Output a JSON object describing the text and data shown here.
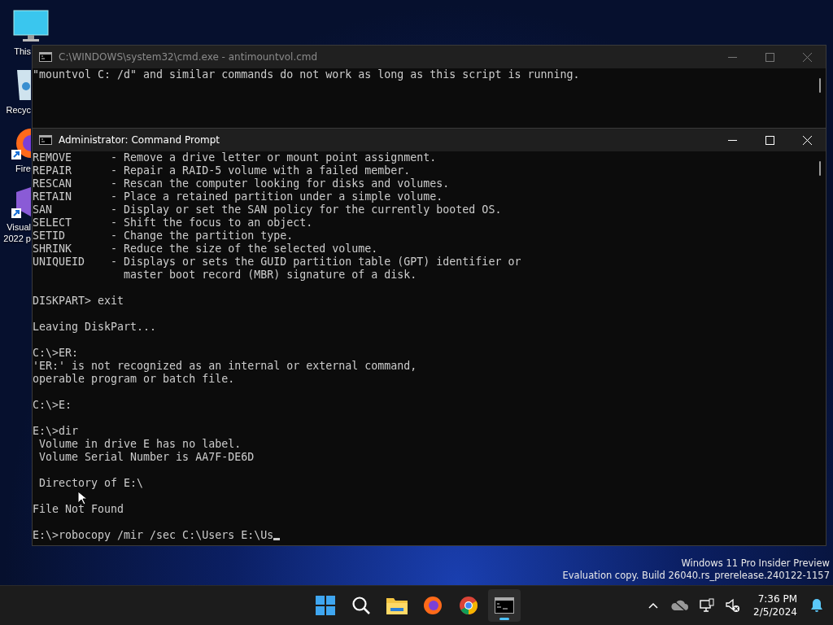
{
  "desktop_icons": [
    {
      "label": "This",
      "kind": "monitor"
    },
    {
      "label": "Recyc",
      "kind": "bin"
    },
    {
      "label": "Fire",
      "kind": "firefox"
    },
    {
      "label": "Visual\n2022 p",
      "kind": "vs"
    }
  ],
  "windows": [
    {
      "title": "C:\\WINDOWS\\system32\\cmd.exe - antimountvol.cmd",
      "active": false,
      "blocks": [
        [
          "\"mountvol C: /d\" and similar commands do not work as long as this script is running."
        ]
      ]
    },
    {
      "title": "Administrator: Command Prompt",
      "active": true,
      "blocks": [
        [
          "REMOVE      - Remove a drive letter or mount point assignment.",
          "REPAIR      - Repair a RAID-5 volume with a failed member.",
          "RESCAN      - Rescan the computer looking for disks and volumes.",
          "RETAIN      - Place a retained partition under a simple volume.",
          "SAN         - Display or set the SAN policy for the currently booted OS.",
          "SELECT      - Shift the focus to an object.",
          "SETID       - Change the partition type.",
          "SHRINK      - Reduce the size of the selected volume.",
          "UNIQUEID    - Displays or sets the GUID partition table (GPT) identifier or",
          "              master boot record (MBR) signature of a disk."
        ],
        [
          "DISKPART> exit"
        ],
        [
          "Leaving DiskPart..."
        ],
        [
          "C:\\>ER:",
          "'ER:' is not recognized as an internal or external command,",
          "operable program or batch file."
        ],
        [
          "C:\\>E:"
        ],
        [
          "E:\\>dir",
          " Volume in drive E has no label.",
          " Volume Serial Number is AA7F-DE6D"
        ],
        [
          " Directory of E:\\"
        ],
        [
          "File Not Found"
        ]
      ],
      "input": "E:\\>robocopy /mir /sec C:\\Users E:\\Us"
    }
  ],
  "edition": [
    "Windows 11 Pro Insider Preview",
    "Evaluation copy. Build 26040.rs_prerelease.240122-1157"
  ],
  "taskbar": {
    "apps": [
      {
        "kind": "start",
        "selected": false
      },
      {
        "kind": "search",
        "selected": false
      },
      {
        "kind": "folder",
        "selected": false
      },
      {
        "kind": "firefox",
        "selected": false
      },
      {
        "kind": "chrome",
        "selected": false
      },
      {
        "kind": "terminal",
        "selected": true
      }
    ],
    "time": "7:36 PM",
    "date": "2/5/2024"
  }
}
